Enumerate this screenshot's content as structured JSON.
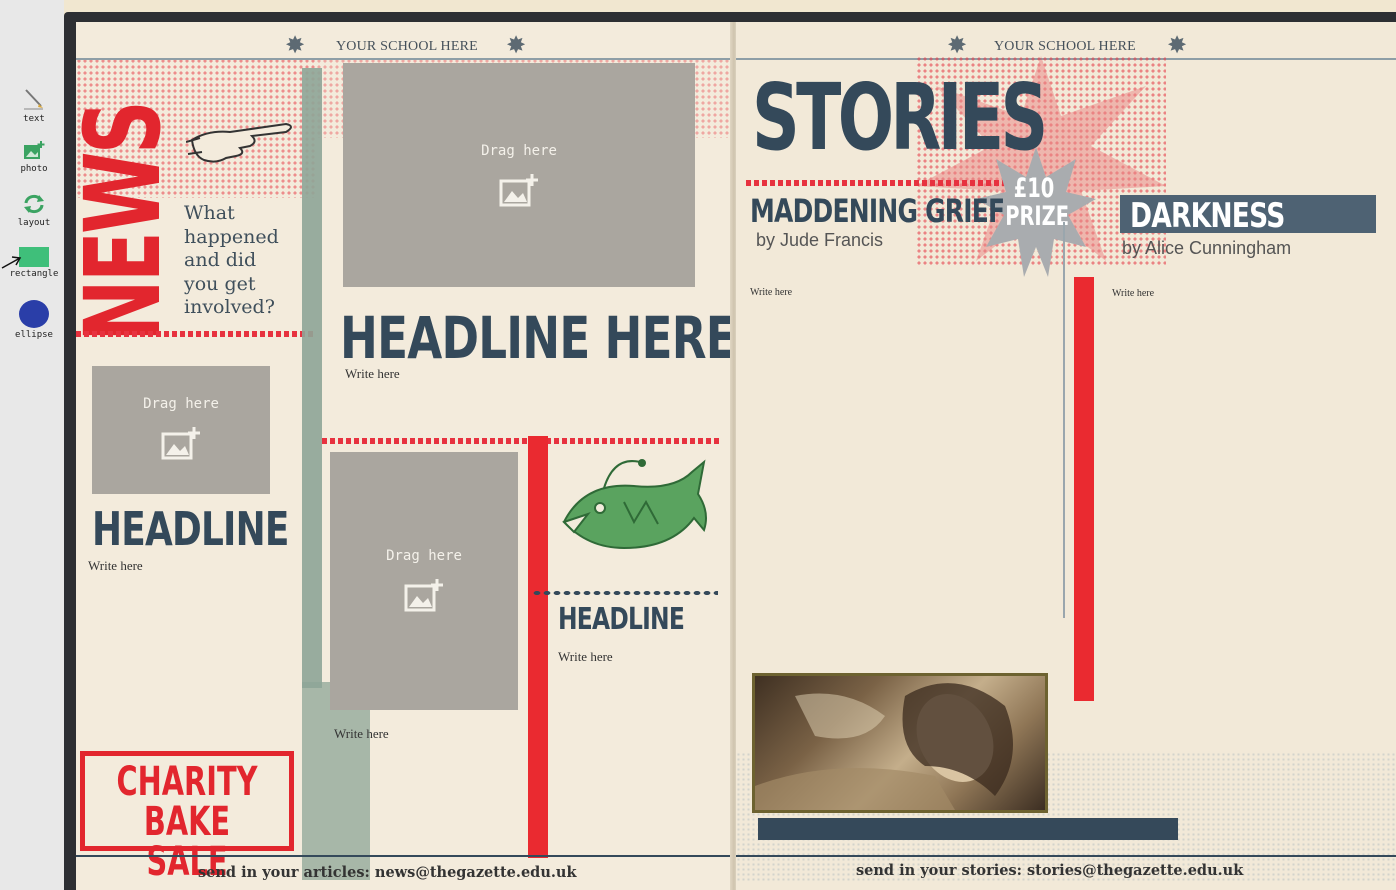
{
  "toolbar": {
    "tools": [
      {
        "label": "text",
        "icon": "pencil-icon"
      },
      {
        "label": "photo",
        "icon": "photo-add-icon"
      },
      {
        "label": "layout",
        "icon": "refresh-arrows-icon"
      },
      {
        "label": "rectangle",
        "icon": "rectangle-icon",
        "color": "#3fbf7a"
      },
      {
        "label": "ellipse",
        "icon": "ellipse-icon",
        "color": "#2a3ea8"
      }
    ]
  },
  "left_page": {
    "school_label": "YOUR SCHOOL HERE",
    "section_title": "NEWS",
    "question": [
      "What",
      "happened",
      "and did",
      "you get",
      "involved?"
    ],
    "drop_label": "Drag here",
    "main_headline": "HEADLINE HERE",
    "main_write": "Write here",
    "small_headline": "HEADLINE",
    "small_write": "Write here",
    "middle_write": "Write here",
    "fish_headline": "HEADLINE",
    "fish_write": "Write here",
    "bake_sale": [
      "CHARITY",
      "BAKE SALE"
    ],
    "footer": "send in your articles: news@thegazette.edu.uk"
  },
  "right_page": {
    "school_label": "YOUR SCHOOL HERE",
    "section_title": "STORIES",
    "prize": [
      "£10",
      "PRIZE"
    ],
    "story1": {
      "title": "MADDENING GRIEF",
      "byline": "by Jude Francis",
      "write": "Write here"
    },
    "story2": {
      "title": "DARKNESS",
      "byline": "by Alice Cunningham",
      "write": "Write here"
    },
    "footer": "send in your stories: stories@thegazette.edu.uk"
  },
  "colors": {
    "accent_red": "#e2262e",
    "navy": "#34495a",
    "sage": "#8ea597",
    "paper": "#f3ebdc"
  }
}
